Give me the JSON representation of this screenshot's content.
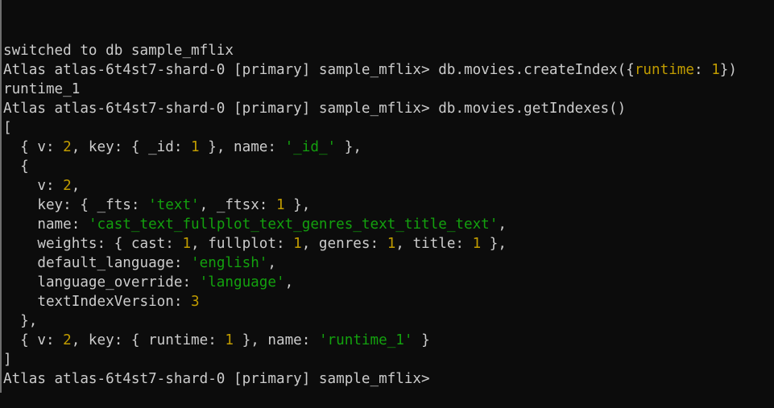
{
  "colors": {
    "background": "#0c0c0c",
    "default_text": "#cccccc",
    "number": "#c19c00",
    "string": "#13a10e"
  },
  "terminal": {
    "lines": [
      [
        {
          "t": "switched to db sample_mflix"
        }
      ],
      [
        {
          "t": "Atlas atlas-6t4st7-shard-0 [primary] sample_mflix> db.movies.createIndex({"
        },
        {
          "t": "runtime",
          "c": "num"
        },
        {
          "t": ": "
        },
        {
          "t": "1",
          "c": "num"
        },
        {
          "t": "})"
        }
      ],
      [
        {
          "t": "runtime_1"
        }
      ],
      [
        {
          "t": "Atlas atlas-6t4st7-shard-0 [primary] sample_mflix> db.movies.getIndexes()"
        }
      ],
      [
        {
          "t": "["
        }
      ],
      [
        {
          "t": "  { v: "
        },
        {
          "t": "2",
          "c": "num"
        },
        {
          "t": ", key: { _id: "
        },
        {
          "t": "1",
          "c": "num"
        },
        {
          "t": " }, name: "
        },
        {
          "t": "'_id_'",
          "c": "str"
        },
        {
          "t": " },"
        }
      ],
      [
        {
          "t": "  {"
        }
      ],
      [
        {
          "t": "    v: "
        },
        {
          "t": "2",
          "c": "num"
        },
        {
          "t": ","
        }
      ],
      [
        {
          "t": "    key: { _fts: "
        },
        {
          "t": "'text'",
          "c": "str"
        },
        {
          "t": ", _ftsx: "
        },
        {
          "t": "1",
          "c": "num"
        },
        {
          "t": " },"
        }
      ],
      [
        {
          "t": "    name: "
        },
        {
          "t": "'cast_text_fullplot_text_genres_text_title_text'",
          "c": "str"
        },
        {
          "t": ","
        }
      ],
      [
        {
          "t": "    weights: { cast: "
        },
        {
          "t": "1",
          "c": "num"
        },
        {
          "t": ", fullplot: "
        },
        {
          "t": "1",
          "c": "num"
        },
        {
          "t": ", genres: "
        },
        {
          "t": "1",
          "c": "num"
        },
        {
          "t": ", title: "
        },
        {
          "t": "1",
          "c": "num"
        },
        {
          "t": " },"
        }
      ],
      [
        {
          "t": "    default_language: "
        },
        {
          "t": "'english'",
          "c": "str"
        },
        {
          "t": ","
        }
      ],
      [
        {
          "t": "    language_override: "
        },
        {
          "t": "'language'",
          "c": "str"
        },
        {
          "t": ","
        }
      ],
      [
        {
          "t": "    textIndexVersion: "
        },
        {
          "t": "3",
          "c": "num"
        }
      ],
      [
        {
          "t": "  },"
        }
      ],
      [
        {
          "t": "  { v: "
        },
        {
          "t": "2",
          "c": "num"
        },
        {
          "t": ", key: { runtime: "
        },
        {
          "t": "1",
          "c": "num"
        },
        {
          "t": " }, name: "
        },
        {
          "t": "'runtime_1'",
          "c": "str"
        },
        {
          "t": " }"
        }
      ],
      [
        {
          "t": "]"
        }
      ],
      [
        {
          "t": "Atlas atlas-6t4st7-shard-0 [primary] sample_mflix> "
        }
      ]
    ]
  }
}
